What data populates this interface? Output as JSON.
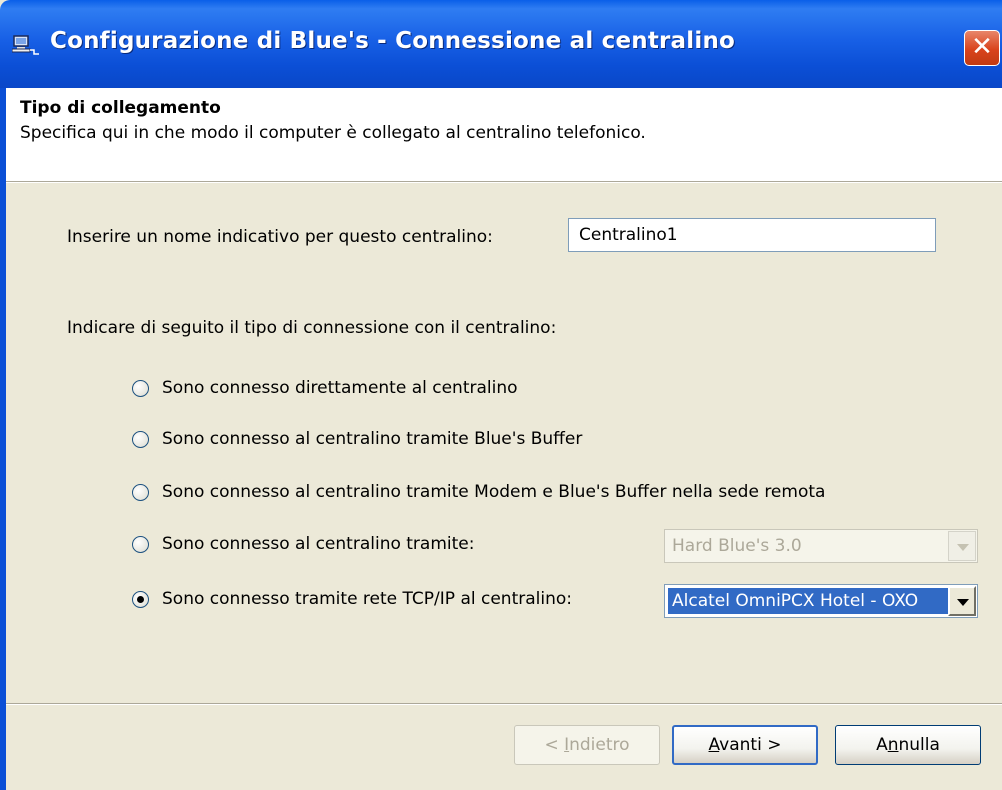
{
  "window": {
    "title": "Configurazione di Blue's - Connessione al centralino"
  },
  "header": {
    "title": "Tipo di collegamento",
    "subtitle": "Specifica qui in che modo il computer è collegato al centralino telefonico."
  },
  "form": {
    "name_label": "Inserire un nome indicativo per questo centralino:",
    "name_value": "Centralino1",
    "connection_label": "Indicare di seguito il tipo di connessione con il centralino:",
    "options": [
      {
        "label": "Sono connesso direttamente al centralino",
        "checked": false
      },
      {
        "label": "Sono connesso al centralino tramite Blue's Buffer",
        "checked": false
      },
      {
        "label": "Sono connesso al centralino tramite Modem e Blue's Buffer nella sede remota",
        "checked": false
      },
      {
        "label": "Sono connesso al centralino tramite:",
        "checked": false
      },
      {
        "label": "Sono connesso tramite rete TCP/IP al centralino:",
        "checked": true
      }
    ],
    "device_combo": {
      "value": "Hard Blue's 3.0",
      "enabled": false
    },
    "pbx_combo": {
      "value": "Alcatel OmniPCX Hotel - OXO",
      "enabled": true
    }
  },
  "buttons": {
    "back_pre": "< ",
    "back_key": "I",
    "back_post": "ndietro",
    "next_key": "A",
    "next_post": "vanti >",
    "cancel_pre": "A",
    "cancel_key": "n",
    "cancel_post": "nulla"
  },
  "colors": {
    "titlebar": "#0b4fd6",
    "dialog_bg": "#ece9d8",
    "selection": "#316ac5",
    "close": "#d9431c"
  },
  "icons": {
    "title": "computer-network-icon",
    "close": "close-icon",
    "dropdown": "chevron-down-icon"
  }
}
